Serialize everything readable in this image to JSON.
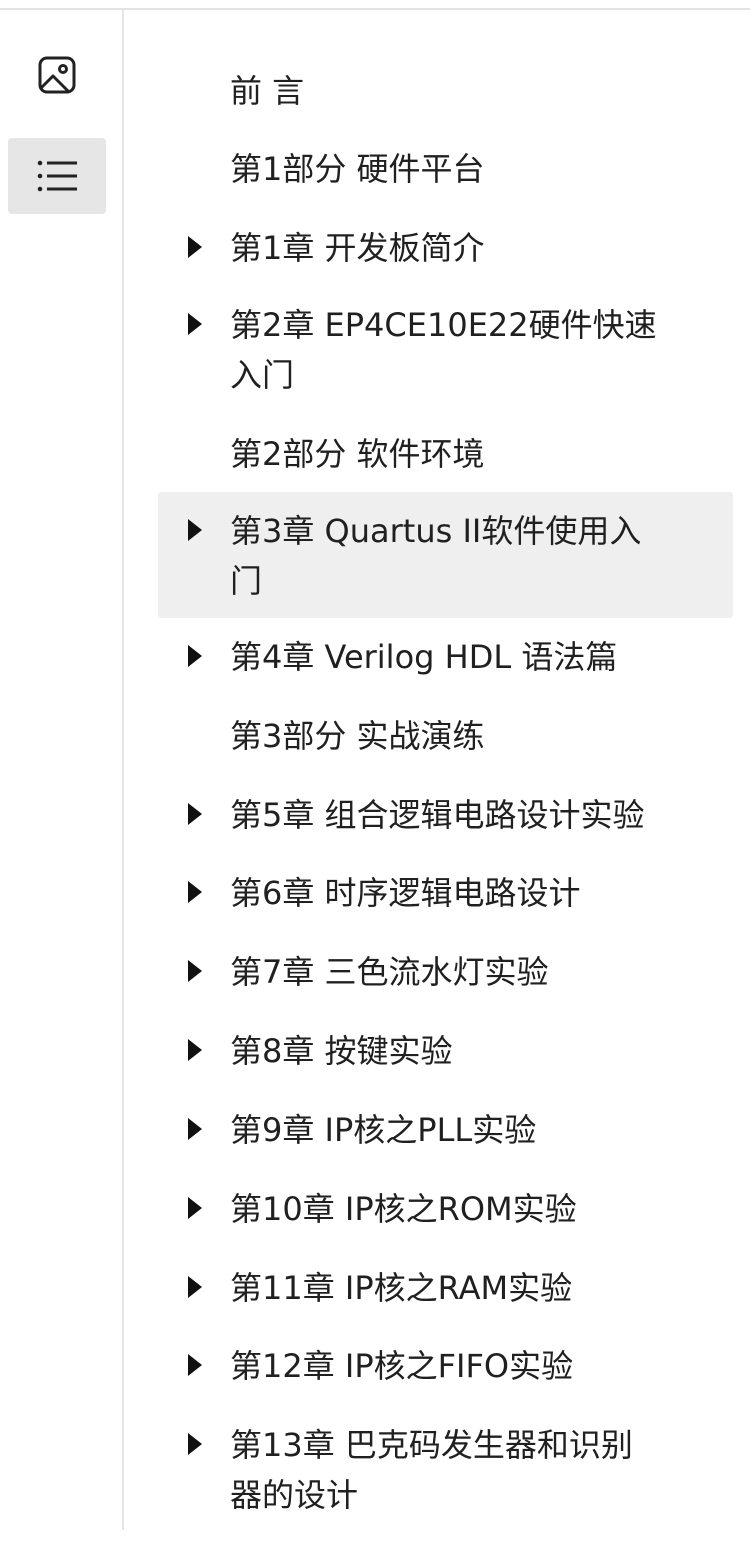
{
  "rail": {
    "thumbnails_icon": "image-icon",
    "outline_icon": "list-icon"
  },
  "toc": {
    "items": [
      {
        "label": "前 言",
        "has_children": false
      },
      {
        "label": "第1部分 硬件平台",
        "has_children": false
      },
      {
        "label": "第1章 开发板简介",
        "has_children": true
      },
      {
        "label": "第2章 EP4CE10E22硬件快速入门",
        "has_children": true
      },
      {
        "label": "第2部分 软件环境",
        "has_children": false
      },
      {
        "label": "第3章 Quartus II软件使用入门",
        "has_children": true,
        "selected": true
      },
      {
        "label": "第4章 Verilog HDL 语法篇",
        "has_children": true
      },
      {
        "label": "第3部分 实战演练",
        "has_children": false
      },
      {
        "label": "第5章 组合逻辑电路设计实验",
        "has_children": true
      },
      {
        "label": "第6章 时序逻辑电路设计",
        "has_children": true
      },
      {
        "label": "第7章 三色流水灯实验",
        "has_children": true
      },
      {
        "label": "第8章 按键实验",
        "has_children": true
      },
      {
        "label": "第9章 IP核之PLL实验",
        "has_children": true
      },
      {
        "label": "第10章 IP核之ROM实验",
        "has_children": true
      },
      {
        "label": "第11章 IP核之RAM实验",
        "has_children": true
      },
      {
        "label": "第12章 IP核之FIFO实验",
        "has_children": true
      },
      {
        "label": "第13章 巴克码发生器和识别器的设计",
        "has_children": true
      }
    ]
  }
}
